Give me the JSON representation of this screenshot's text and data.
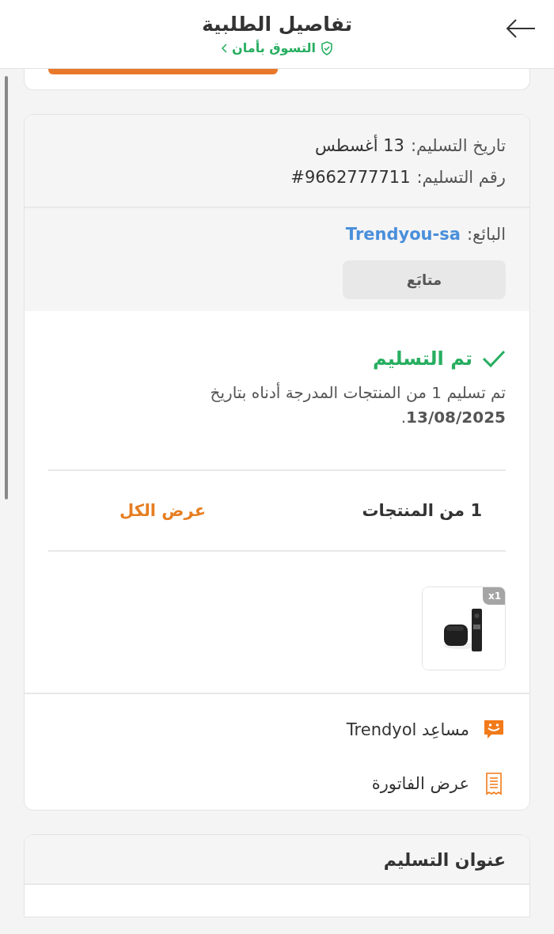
{
  "header": {
    "title": "تفاصيل الطلبية",
    "subtitle": "التسوق بأمان"
  },
  "partial_card": {
    "kind": "cut_off"
  },
  "shipment": {
    "date_label": "تاريخ التسليم:",
    "date": "13 أغسطس",
    "number_label": "رقم التسليم:",
    "number": "#9662777711",
    "seller_label": "البائع:",
    "seller": "Trendyou-sa",
    "follow_button": "متابَع",
    "status": "تم التسليم",
    "message": "تم تسليم 1 من المنتجات المدرجة أدناه بتاريخ **13/08/2025**.",
    "products_count": "1 من المنتجات",
    "view_all": "عرض الكل",
    "products": [
      {
        "kind": "picture",
        "quantity": "x1"
      }
    ],
    "actions": [
      {
        "kind": "assistant",
        "label": "مساعِد Trendyol"
      },
      {
        "kind": "invoice",
        "label": "عرض الفاتورة"
      }
    ]
  },
  "address": {
    "title": "عنوان التسليم"
  }
}
